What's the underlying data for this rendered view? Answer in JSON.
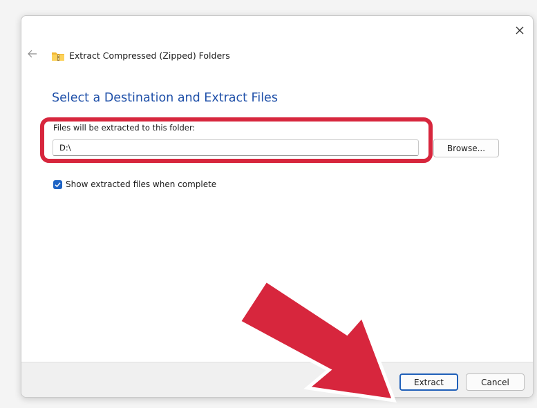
{
  "window": {
    "title": "Extract Compressed (Zipped) Folders",
    "close_icon": "close-icon",
    "back_icon": "back-arrow-icon",
    "app_icon": "zip-folder-icon"
  },
  "main": {
    "heading": "Select a Destination and Extract Files",
    "field_label": "Files will be extracted to this folder:",
    "path_value": "D:\\",
    "browse_label": "Browse...",
    "checkbox_label": "Show extracted files when complete",
    "checkbox_checked": true
  },
  "footer": {
    "extract_label": "Extract",
    "cancel_label": "Cancel"
  },
  "colors": {
    "accent": "#1e63c4",
    "heading": "#1e4fa8",
    "annotation": "#d7263d"
  }
}
